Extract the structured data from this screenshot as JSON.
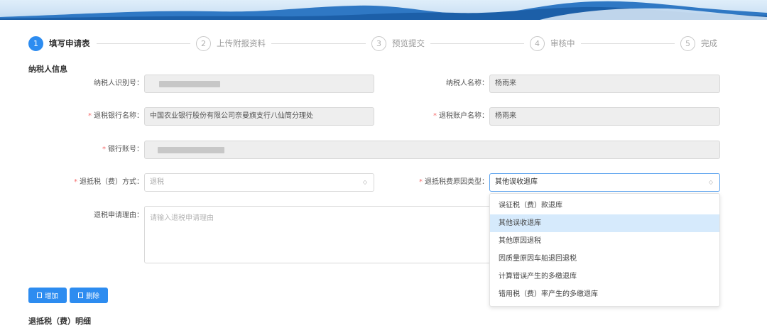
{
  "steps": [
    {
      "num": "1",
      "label": "填写申请表",
      "active": true
    },
    {
      "num": "2",
      "label": "上传附报资料",
      "active": false
    },
    {
      "num": "3",
      "label": "预览提交",
      "active": false
    },
    {
      "num": "4",
      "label": "审核中",
      "active": false
    },
    {
      "num": "5",
      "label": "完成",
      "active": false
    }
  ],
  "section_taxpayer": "纳税人信息",
  "form": {
    "taxpayer_id_label": "纳税人识别号：",
    "taxpayer_name_label": "纳税人名称：",
    "taxpayer_name_value": "杨雨来",
    "bank_name_label": "退税银行名称：",
    "bank_name_value": "中国农业银行股份有限公司奈曼旗支行八仙筒分理处",
    "account_name_label": "退税账户名称：",
    "account_name_value": "杨雨来",
    "bank_account_label": "银行账号：",
    "refund_method_label": "退抵税（费）方式：",
    "refund_method_value": "退税",
    "reason_type_label": "退抵税费原因类型：",
    "reason_type_value": "其他误收退库",
    "reason_label": "退税申请理由：",
    "reason_placeholder": "请输入退税申请理由"
  },
  "required_mark": "*",
  "buttons": {
    "add": "增加",
    "delete": "删除"
  },
  "section_detail": "退抵税（费）明细",
  "dropdown_options": [
    "误征税（费）款退库",
    "其他误收退库",
    "其他原因退税",
    "因质量原因车船退回退税",
    "计算错误产生的多缴退库",
    "错用税（费）率产生的多缴退库"
  ],
  "dropdown_selected_index": 1,
  "colors": {
    "accent": "#2d8cf0",
    "required": "#f56c6c",
    "selected_option": "#d6eafc"
  }
}
